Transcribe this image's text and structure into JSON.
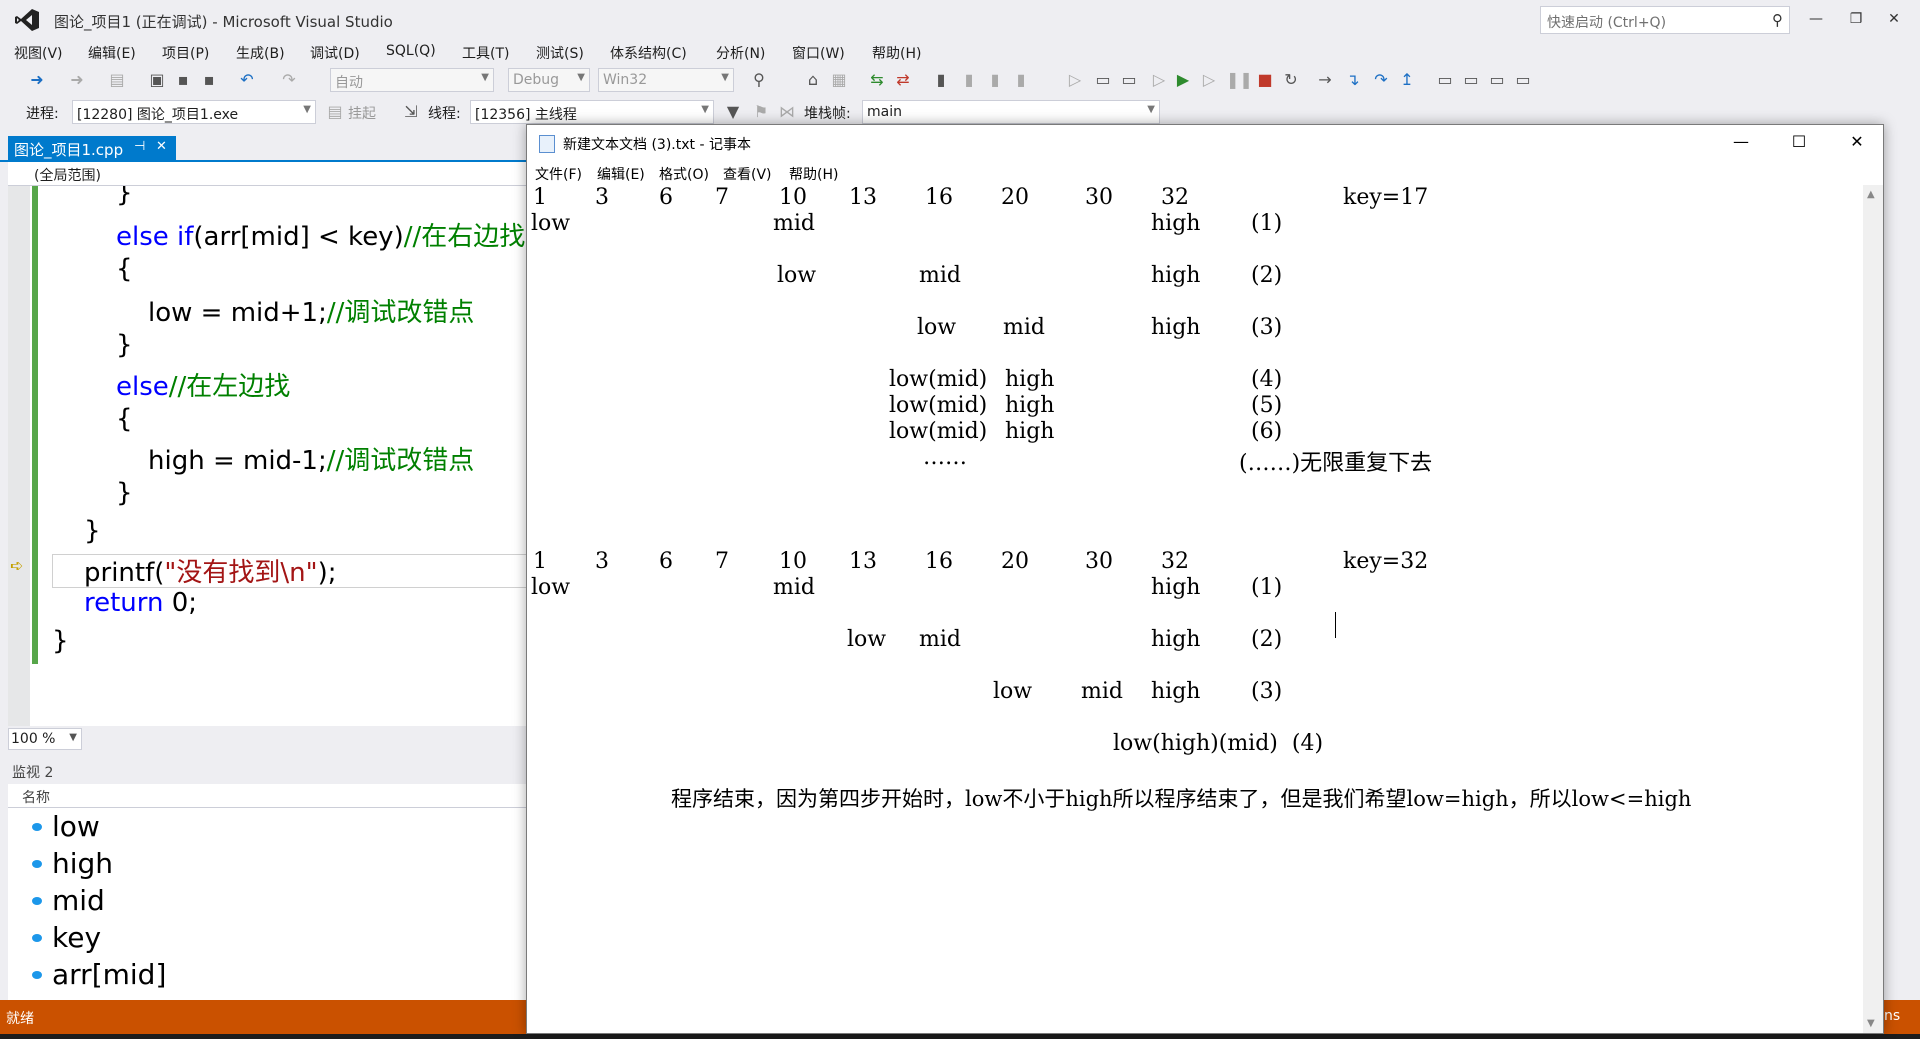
{
  "vs": {
    "title": "图论_项目1 (正在调试) - Microsoft Visual Studio",
    "quick_launch_placeholder": "快速启动 (Ctrl+Q)",
    "menu": [
      "视图(V)",
      "编辑(E)",
      "项目(P)",
      "生成(B)",
      "调试(D)",
      "SQL(Q)",
      "工具(T)",
      "测试(S)",
      "体系结构(C)",
      "分析(N)",
      "窗口(W)",
      "帮助(H)"
    ],
    "toolbar": {
      "solution_config_placeholder": "自动",
      "config": "Debug",
      "platform": "Win32"
    },
    "debug_toolbar": {
      "process_label": "进程:",
      "process_value": "[12280] 图论_项目1.exe",
      "suspend_label": "挂起",
      "thread_label": "线程:",
      "thread_value": "[12356] 主线程",
      "stack_label": "堆栈帧:",
      "stack_value": "main"
    },
    "doc_tab": "图论_项目1.cpp",
    "scope": "(全局范围)",
    "zoom": "100 %",
    "code": {
      "l1": "}",
      "l2_kw": "else if",
      "l2_code": "(arr[mid] < key)",
      "l2_cm": "//在右边找",
      "l3": "{",
      "l4_code": "low = mid+1;",
      "l4_cm": "//调试改错点",
      "l5": "}",
      "l6_kw": "else",
      "l6_cm": "//在左边找",
      "l7": "{",
      "l8_code": "high = mid-1;",
      "l8_cm": "//调试改错点",
      "l9": "}",
      "l10": "}",
      "l11_pre": "printf(",
      "l11_str": "\"没有找到\\n\"",
      "l11_post": ");",
      "l12_kw": "return",
      "l12_code": " 0;",
      "l13": "}"
    },
    "watch": {
      "title": "监视 2",
      "column": "名称",
      "items": [
        "low",
        "high",
        "mid",
        "key",
        "arr[mid]"
      ]
    },
    "status": "就绪",
    "status_right": "ns"
  },
  "notepad": {
    "title": "新建文本文档 (3).txt - 记事本",
    "menu": [
      "文件(F)",
      "编辑(E)",
      "格式(O)",
      "查看(V)",
      "帮助(H)"
    ],
    "block1": {
      "numbers": [
        "1",
        "3",
        "6",
        "7",
        "10",
        "13",
        "16",
        "20",
        "30",
        "32"
      ],
      "key": "key=17",
      "step1": {
        "low": "low",
        "mid": "mid",
        "high": "high",
        "num": "(1)"
      },
      "step2": {
        "low": "low",
        "mid": "mid",
        "high": "high",
        "num": "(2)"
      },
      "step3": {
        "low": "low",
        "mid": "mid",
        "high": "high",
        "num": "(3)"
      },
      "step4": {
        "low": "low(mid)",
        "high": "high",
        "num": "(4)"
      },
      "step5": {
        "low": "low(mid)",
        "high": "high",
        "num": "(5)"
      },
      "step6": {
        "low": "low(mid)",
        "high": "high",
        "num": "(6)"
      },
      "ellipsis": "……",
      "repeat": "(……)无限重复下去"
    },
    "block2": {
      "numbers": [
        "1",
        "3",
        "6",
        "7",
        "10",
        "13",
        "16",
        "20",
        "30",
        "32"
      ],
      "key": "key=32",
      "step1": {
        "low": "low",
        "mid": "mid",
        "high": "high",
        "num": "(1)"
      },
      "step2": {
        "low": "low",
        "mid": "mid",
        "high": "high",
        "num": "(2)"
      },
      "step3": {
        "low": "low",
        "mid": "mid",
        "high": "high",
        "num": "(3)"
      },
      "step4": "low(high)(mid)  (4)"
    },
    "conclusion": "程序结束，因为第四步开始时，low不小于high所以程序结束了，但是我们希望low=high，所以low<=high"
  }
}
